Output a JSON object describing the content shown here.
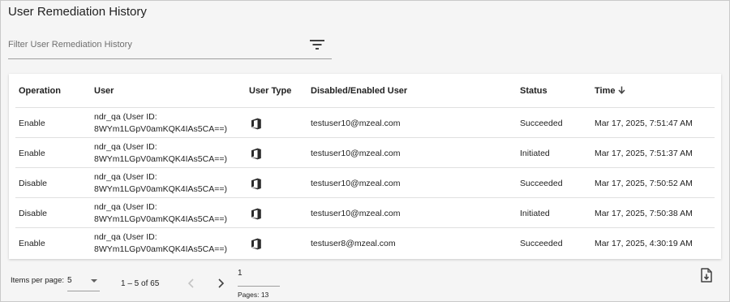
{
  "page": {
    "title": "User Remediation History"
  },
  "filter": {
    "placeholder": "Filter User Remediation History",
    "icon": "filter-list-icon"
  },
  "table": {
    "headers": {
      "operation": "Operation",
      "user": "User",
      "user_type": "User Type",
      "disabled_enabled_user": "Disabled/Enabled User",
      "status": "Status",
      "time": "Time",
      "time_sort_icon": "arrow-down-icon"
    },
    "rows": [
      {
        "operation": "Enable",
        "user_line1": "ndr_qa (User ID:",
        "user_line2": "8WYm1LGpV0amKQK4IAs5CA==)",
        "user_type_icon": "microsoft-office-icon",
        "target_user": "testuser10@mzeal.com",
        "status": "Succeeded",
        "time": "Mar 17, 2025, 7:51:47 AM"
      },
      {
        "operation": "Enable",
        "user_line1": "ndr_qa (User ID:",
        "user_line2": "8WYm1LGpV0amKQK4IAs5CA==)",
        "user_type_icon": "microsoft-office-icon",
        "target_user": "testuser10@mzeal.com",
        "status": "Initiated",
        "time": "Mar 17, 2025, 7:51:37 AM"
      },
      {
        "operation": "Disable",
        "user_line1": "ndr_qa (User ID:",
        "user_line2": "8WYm1LGpV0amKQK4IAs5CA==)",
        "user_type_icon": "microsoft-office-icon",
        "target_user": "testuser10@mzeal.com",
        "status": "Succeeded",
        "time": "Mar 17, 2025, 7:50:52 AM"
      },
      {
        "operation": "Disable",
        "user_line1": "ndr_qa (User ID:",
        "user_line2": "8WYm1LGpV0amKQK4IAs5CA==)",
        "user_type_icon": "microsoft-office-icon",
        "target_user": "testuser10@mzeal.com",
        "status": "Initiated",
        "time": "Mar 17, 2025, 7:50:38 AM"
      },
      {
        "operation": "Enable",
        "user_line1": "ndr_qa (User ID:",
        "user_line2": "8WYm1LGpV0amKQK4IAs5CA==)",
        "user_type_icon": "microsoft-office-icon",
        "target_user": "testuser8@mzeal.com",
        "status": "Succeeded",
        "time": "Mar 17, 2025, 4:30:19 AM"
      }
    ]
  },
  "paginator": {
    "items_per_page_label": "Items per page:",
    "items_per_page_value": "5",
    "range_label": "1 – 5 of 65",
    "prev_icon": "chevron-left-icon",
    "next_icon": "chevron-right-icon",
    "current_page": "1",
    "pages_label": "Pages: 13",
    "export_icon": "file-export-icon"
  },
  "colors": {
    "background": "#f5f5f5",
    "card": "#ffffff",
    "text": "#212121",
    "divider": "#e0e0e0"
  }
}
